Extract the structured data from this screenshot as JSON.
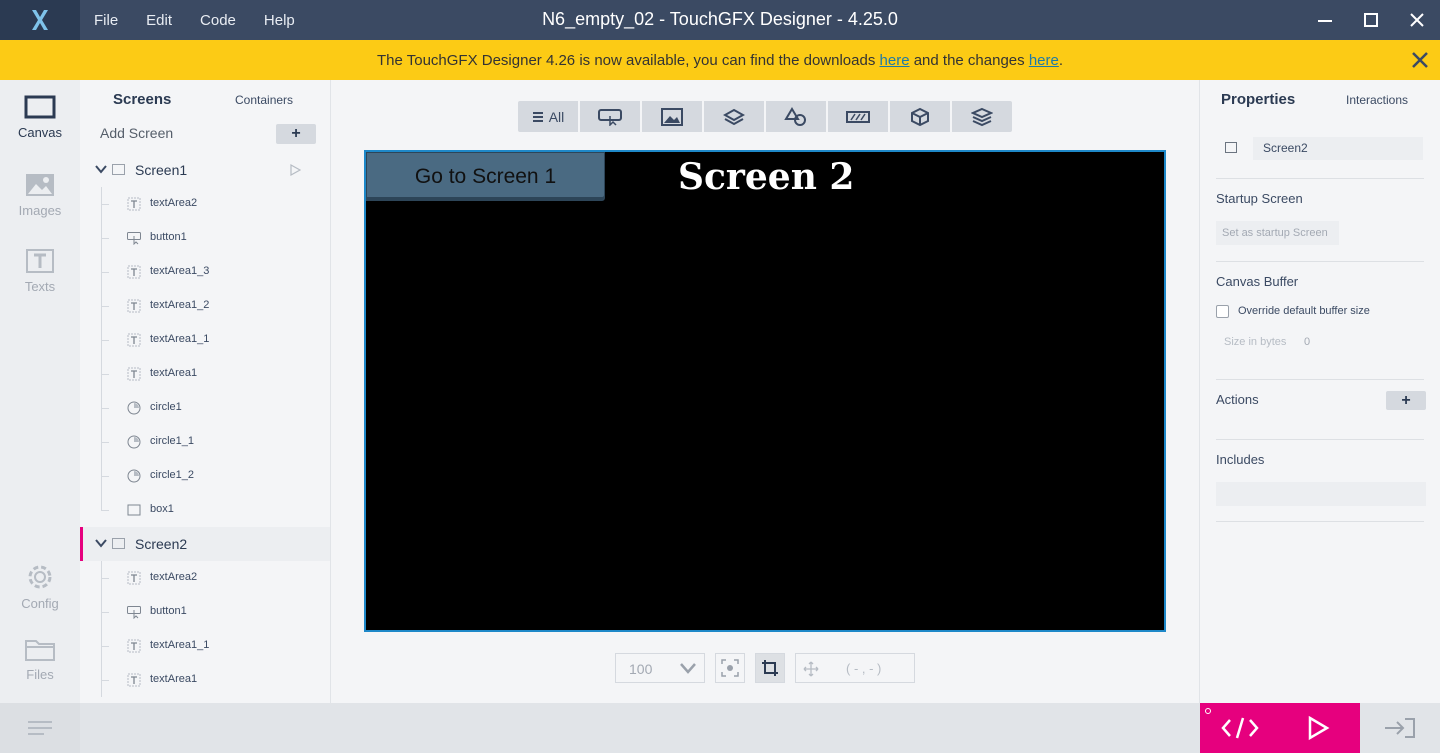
{
  "menu": [
    "File",
    "Edit",
    "Code",
    "Help"
  ],
  "window_title": "N6_empty_02 - TouchGFX Designer - 4.25.0",
  "banner": {
    "text_before": "The TouchGFX Designer 4.26 is now available, you can find the downloads ",
    "link1": "here",
    "text_middle": " and the changes ",
    "link2": "here",
    "text_after": "."
  },
  "rail": {
    "canvas": "Canvas",
    "images": "Images",
    "texts": "Texts",
    "config": "Config",
    "files": "Files"
  },
  "tree": {
    "tab_screens": "Screens",
    "tab_containers": "Containers",
    "add_screen": "Add Screen",
    "add_symbol": "+",
    "screen1": {
      "name": "Screen1",
      "children": [
        {
          "label": "textArea2",
          "icon": "text-icon"
        },
        {
          "label": "button1",
          "icon": "button-icon"
        },
        {
          "label": "textArea1_3",
          "icon": "text-icon"
        },
        {
          "label": "textArea1_2",
          "icon": "text-icon"
        },
        {
          "label": "textArea1_1",
          "icon": "text-icon"
        },
        {
          "label": "textArea1",
          "icon": "text-icon"
        },
        {
          "label": "circle1",
          "icon": "circle-icon"
        },
        {
          "label": "circle1_1",
          "icon": "circle-icon"
        },
        {
          "label": "circle1_2",
          "icon": "circle-icon"
        },
        {
          "label": "box1",
          "icon": "box-icon"
        }
      ]
    },
    "screen2": {
      "name": "Screen2",
      "children": [
        {
          "label": "textArea2",
          "icon": "text-icon"
        },
        {
          "label": "button1",
          "icon": "button-icon"
        },
        {
          "label": "textArea1_1",
          "icon": "text-icon"
        },
        {
          "label": "textArea1",
          "icon": "text-icon"
        }
      ]
    }
  },
  "toolbar": {
    "all": "All"
  },
  "stage": {
    "button_label": "Go to Screen 1",
    "title": "Screen 2"
  },
  "bottom": {
    "zoom": "100",
    "coords": "( - , - )"
  },
  "props": {
    "title": "Properties",
    "interactions": "Interactions",
    "name_value": "Screen2",
    "startup_title": "Startup Screen",
    "startup_btn": "Set as startup Screen",
    "buffer_title": "Canvas Buffer",
    "override": "Override default buffer size",
    "size_label": "Size in bytes",
    "size_value": "0",
    "actions": "Actions",
    "includes": "Includes",
    "add_symbol": "+"
  },
  "colors": {
    "titlebar": "#3b4a63",
    "banner": "#fccb15",
    "accent": "#e6007e",
    "stage_border": "#1e88c8"
  }
}
